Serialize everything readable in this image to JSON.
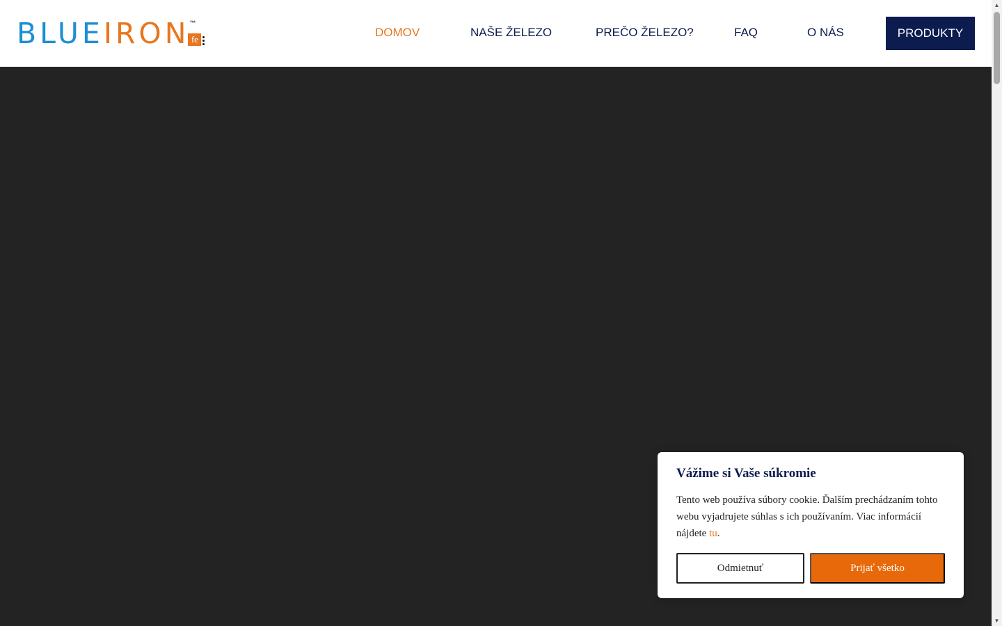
{
  "logo": {
    "text_blue": "BLUE",
    "text_orange": "IRON",
    "tm": "™",
    "fe": "fe"
  },
  "nav": {
    "items": [
      {
        "label": "DOMOV",
        "active": true
      },
      {
        "label": "NAŠE ŽELEZO",
        "active": false
      },
      {
        "label": "PREČO ŽELEZO?",
        "active": false
      },
      {
        "label": "FAQ",
        "active": false
      },
      {
        "label": "O NÁS",
        "active": false
      }
    ],
    "cta_label": "PRODUKTY"
  },
  "cookie": {
    "title": "Vážime si Vaše súkromie",
    "text": "Tento web používa súbory cookie. Ďalším prechádzaním tohto webu vyjadrujete súhlas s ich používaním. Viac informácií nájdete ",
    "link_label": "tu",
    "text_end": ".",
    "decline_label": "Odmietnuť",
    "accept_label": "Prijať všetko"
  },
  "scrollbar": {
    "up_icon": "▲",
    "down_icon": "▼"
  },
  "colors": {
    "brand_blue": "#1b8fd6",
    "brand_orange": "#e8761e",
    "navy": "#0d1c4f",
    "hero_bg": "#232323"
  }
}
